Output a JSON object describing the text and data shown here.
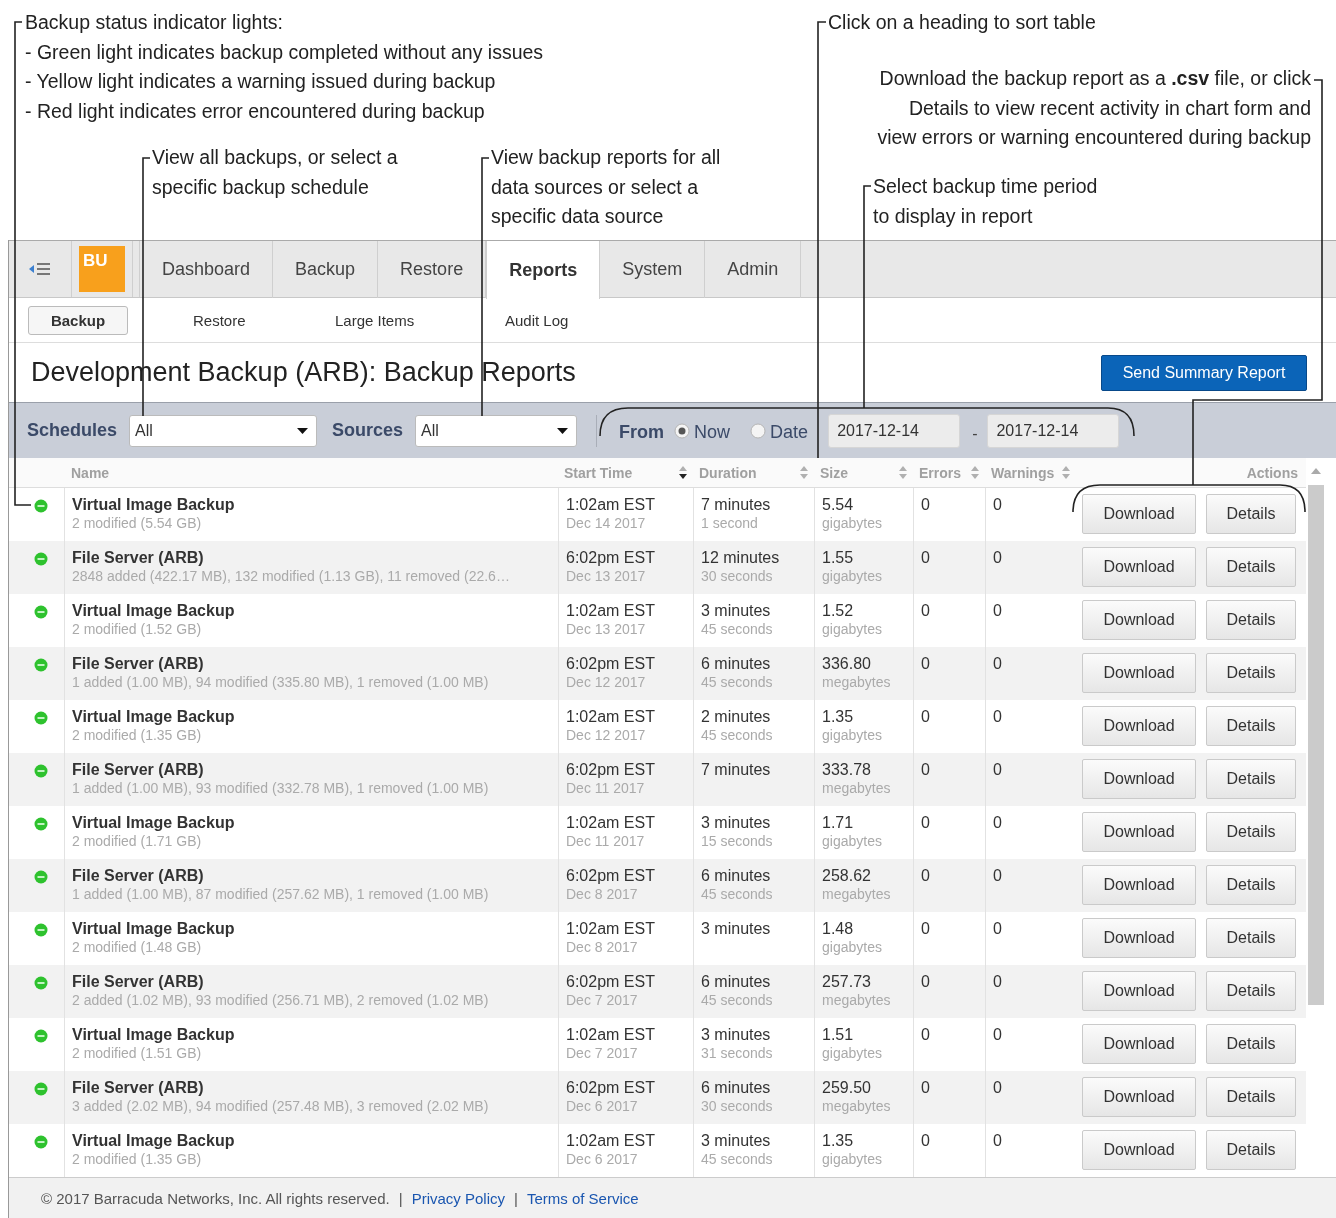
{
  "callouts": [
    {
      "lines": [
        "Backup status indicator lights:",
        "- Green light indicates backup completed without any issues",
        "- Yellow light indicates a warning issued during backup",
        "- Red light indicates error encountered during backup"
      ]
    },
    {
      "lines": [
        "View all backups, or select a",
        "specific backup schedule"
      ]
    },
    {
      "lines": [
        "View backup reports for all",
        "data sources or select a",
        "specific data source"
      ]
    },
    {
      "lines": [
        "Click on a heading to sort table"
      ]
    },
    {
      "lines": [
        "Download the backup report as a **.csv** file, or click",
        "Details to view recent activity in chart form and",
        "view errors or warning encountered during backup"
      ]
    },
    {
      "lines": [
        "Select backup time period",
        "to display in report"
      ]
    }
  ],
  "app": {
    "logo": "BU",
    "tabs": [
      {
        "label": "Dashboard",
        "selected": false
      },
      {
        "label": "Backup",
        "selected": false
      },
      {
        "label": "Restore",
        "selected": false
      },
      {
        "label": "Reports",
        "selected": true
      },
      {
        "label": "System",
        "selected": false
      },
      {
        "label": "Admin",
        "selected": false
      }
    ],
    "subtabs": [
      {
        "label": "Backup",
        "selected": true
      },
      {
        "label": "Restore",
        "selected": false
      },
      {
        "label": "Large Items",
        "selected": false
      },
      {
        "label": "Audit Log",
        "selected": false
      }
    ],
    "page_title": "Development Backup (ARB): Backup Reports",
    "summary_button": "Send Summary Report",
    "filters": {
      "schedules": {
        "label": "Schedules",
        "value": "All"
      },
      "sources": {
        "label": "Sources",
        "value": "All"
      },
      "period": {
        "label": "From",
        "options": [
          {
            "label": "Now",
            "selected": true
          },
          {
            "label": "Date",
            "selected": false
          }
        ],
        "date_from": "2017-12-14",
        "range_separator": "-",
        "date_to": "2017-12-14"
      }
    },
    "table": {
      "columns": [
        {
          "label": "Name"
        },
        {
          "label": "Start Time",
          "sorted": true
        },
        {
          "label": "Duration",
          "sorted": false
        },
        {
          "label": "Size",
          "sorted": false
        },
        {
          "label": "Errors",
          "sorted": false
        },
        {
          "label": "Warnings",
          "sorted": false
        },
        {
          "label": "Actions"
        }
      ],
      "rows": [
        {
          "color": "#2ec22e",
          "name": "Virtual Image Backup",
          "summary": "2 modified (5.54 GB)",
          "start_time": "1:02am EST",
          "start_date": "Dec 14 2017",
          "duration": "7 minutes",
          "duration_extra": "1 second",
          "size": "5.54",
          "size_unit": "gigabytes",
          "errors": "0",
          "warnings": "0",
          "actions": [
            "Download",
            "Details"
          ]
        },
        {
          "color": "#2ec22e",
          "name": "File Server (ARB)",
          "summary": "2848 added (422.17 MB), 132 modified (1.13 GB), 11 removed (22.6…",
          "start_time": "6:02pm EST",
          "start_date": "Dec 13 2017",
          "duration": "12 minutes",
          "duration_extra": "30 seconds",
          "size": "1.55",
          "size_unit": "gigabytes",
          "errors": "0",
          "warnings": "0",
          "actions": [
            "Download",
            "Details"
          ]
        },
        {
          "color": "#2ec22e",
          "name": "Virtual Image Backup",
          "summary": "2 modified (1.52 GB)",
          "start_time": "1:02am EST",
          "start_date": "Dec 13 2017",
          "duration": "3 minutes",
          "duration_extra": "45 seconds",
          "size": "1.52",
          "size_unit": "gigabytes",
          "errors": "0",
          "warnings": "0",
          "actions": [
            "Download",
            "Details"
          ]
        },
        {
          "color": "#2ec22e",
          "name": "File Server (ARB)",
          "summary": "1 added (1.00 MB), 94 modified (335.80 MB), 1 removed (1.00 MB)",
          "start_time": "6:02pm EST",
          "start_date": "Dec 12 2017",
          "duration": "6 minutes",
          "duration_extra": "45 seconds",
          "size": "336.80",
          "size_unit": "megabytes",
          "errors": "0",
          "warnings": "0",
          "actions": [
            "Download",
            "Details"
          ]
        },
        {
          "color": "#2ec22e",
          "name": "Virtual Image Backup",
          "summary": "2 modified (1.35 GB)",
          "start_time": "1:02am EST",
          "start_date": "Dec 12 2017",
          "duration": "2 minutes",
          "duration_extra": "45 seconds",
          "size": "1.35",
          "size_unit": "gigabytes",
          "errors": "0",
          "warnings": "0",
          "actions": [
            "Download",
            "Details"
          ]
        },
        {
          "color": "#2ec22e",
          "name": "File Server (ARB)",
          "summary": "1 added (1.00 MB), 93 modified (332.78 MB), 1 removed (1.00 MB)",
          "start_time": "6:02pm EST",
          "start_date": "Dec 11 2017",
          "duration": "7 minutes",
          "size": "333.78",
          "size_unit": "megabytes",
          "errors": "0",
          "warnings": "0",
          "actions": [
            "Download",
            "Details"
          ]
        },
        {
          "color": "#2ec22e",
          "name": "Virtual Image Backup",
          "summary": "2 modified (1.71 GB)",
          "start_time": "1:02am EST",
          "start_date": "Dec 11 2017",
          "duration": "3 minutes",
          "duration_extra": "15 seconds",
          "size": "1.71",
          "size_unit": "gigabytes",
          "errors": "0",
          "warnings": "0",
          "actions": [
            "Download",
            "Details"
          ]
        },
        {
          "color": "#2ec22e",
          "name": "File Server (ARB)",
          "summary": "1 added (1.00 MB), 87 modified (257.62 MB), 1 removed (1.00 MB)",
          "start_time": "6:02pm EST",
          "start_date": "Dec 8 2017",
          "duration": "6 minutes",
          "duration_extra": "45 seconds",
          "size": "258.62",
          "size_unit": "megabytes",
          "errors": "0",
          "warnings": "0",
          "actions": [
            "Download",
            "Details"
          ]
        },
        {
          "color": "#2ec22e",
          "name": "Virtual Image Backup",
          "summary": "2 modified (1.48 GB)",
          "start_time": "1:02am EST",
          "start_date": "Dec 8 2017",
          "duration": "3 minutes",
          "size": "1.48",
          "size_unit": "gigabytes",
          "errors": "0",
          "warnings": "0",
          "actions": [
            "Download",
            "Details"
          ]
        },
        {
          "color": "#2ec22e",
          "name": "File Server (ARB)",
          "summary": "2 added (1.02 MB), 93 modified (256.71 MB), 2 removed (1.02 MB)",
          "start_time": "6:02pm EST",
          "start_date": "Dec 7 2017",
          "duration": "6 minutes",
          "duration_extra": "45 seconds",
          "size": "257.73",
          "size_unit": "megabytes",
          "errors": "0",
          "warnings": "0",
          "actions": [
            "Download",
            "Details"
          ]
        },
        {
          "color": "#2ec22e",
          "name": "Virtual Image Backup",
          "summary": "2 modified (1.51 GB)",
          "start_time": "1:02am EST",
          "start_date": "Dec 7 2017",
          "duration": "3 minutes",
          "duration_extra": "31 seconds",
          "size": "1.51",
          "size_unit": "gigabytes",
          "errors": "0",
          "warnings": "0",
          "actions": [
            "Download",
            "Details"
          ]
        },
        {
          "color": "#2ec22e",
          "name": "File Server (ARB)",
          "summary": "3 added (2.02 MB), 94 modified (257.48 MB), 3 removed (2.02 MB)",
          "start_time": "6:02pm EST",
          "start_date": "Dec 6 2017",
          "duration": "6 minutes",
          "duration_extra": "30 seconds",
          "size": "259.50",
          "size_unit": "megabytes",
          "errors": "0",
          "warnings": "0",
          "actions": [
            "Download",
            "Details"
          ]
        },
        {
          "color": "#2ec22e",
          "name": "Virtual Image Backup",
          "summary": "2 modified (1.35 GB)",
          "start_time": "1:02am EST",
          "start_date": "Dec 6 2017",
          "duration": "3 minutes",
          "duration_extra": "45 seconds",
          "size": "1.35",
          "size_unit": "gigabytes",
          "errors": "0",
          "warnings": "0",
          "actions": [
            "Download",
            "Details"
          ]
        }
      ]
    },
    "footer": [
      {
        "kind": "text",
        "text": "© 2017 Barracuda Networks, Inc. All rights reserved."
      },
      {
        "kind": "separator",
        "text": "|"
      },
      {
        "kind": "link",
        "text": "Privacy Policy"
      },
      {
        "kind": "separator",
        "text": "|"
      },
      {
        "kind": "link",
        "text": "Terms of Service"
      }
    ]
  }
}
